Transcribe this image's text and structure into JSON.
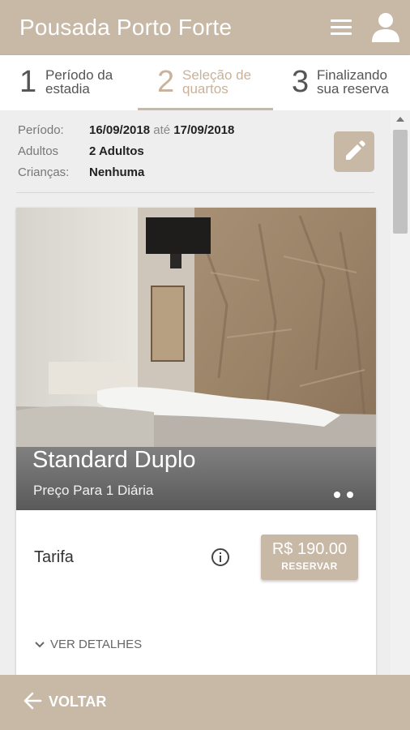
{
  "header": {
    "title": "Pousada Porto Forte",
    "menu_icon": "hamburger-menu-icon",
    "user_icon": "user-icon"
  },
  "steps": [
    {
      "number": "1",
      "label": "Período da\nestadia"
    },
    {
      "number": "2",
      "label": "Seleção de\nquartos",
      "active": true
    },
    {
      "number": "3",
      "label": "Finalizando\nsua reserva"
    }
  ],
  "summary": {
    "periodo_label": "Período:",
    "date_from": "16/09/2018",
    "ate": "até",
    "date_to": "17/09/2018",
    "adultos_label": "Adultos",
    "adultos_value": "2 Adultos",
    "criancas_label": "Crianças:",
    "criancas_value": "Nenhuma"
  },
  "room": {
    "name": "Standard Duplo",
    "subtitle": "Preço Para 1 Diária",
    "tarifa_label": "Tarifa",
    "price": "R$ 190.00",
    "reserve_label": "RESERVAR",
    "details_label": "VER DETALHES"
  },
  "footer": {
    "back_label": "VOLTAR"
  },
  "colors": {
    "accent": "#c8b8a6",
    "active_step": "#c8b29b"
  }
}
